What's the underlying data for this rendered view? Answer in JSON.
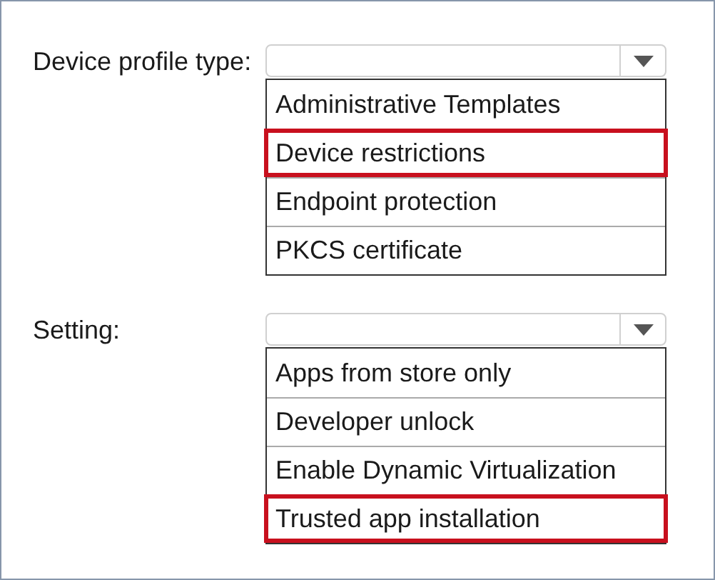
{
  "dropdowns": [
    {
      "label": "Device profile type:",
      "options": [
        {
          "label": "Administrative Templates",
          "selected": false
        },
        {
          "label": "Device restrictions",
          "selected": true
        },
        {
          "label": "Endpoint protection",
          "selected": false
        },
        {
          "label": "PKCS certificate",
          "selected": false
        }
      ]
    },
    {
      "label": "Setting:",
      "options": [
        {
          "label": "Apps from store only",
          "selected": false
        },
        {
          "label": "Developer unlock",
          "selected": false
        },
        {
          "label": "Enable Dynamic Virtualization",
          "selected": false
        },
        {
          "label": "Trusted app installation",
          "selected": true
        }
      ]
    }
  ]
}
